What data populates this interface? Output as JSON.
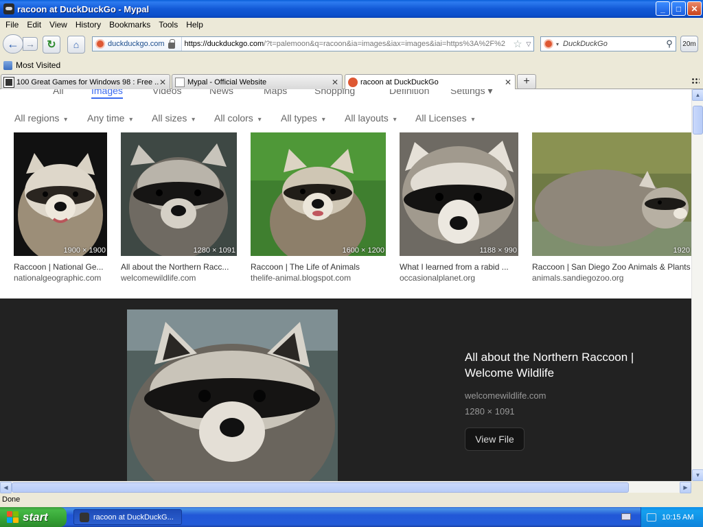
{
  "window": {
    "title": "racoon at DuckDuckGo - Mypal",
    "min": "_",
    "max": "□",
    "close": "✕"
  },
  "menu": [
    "File",
    "Edit",
    "View",
    "History",
    "Bookmarks",
    "Tools",
    "Help"
  ],
  "nav": {
    "back": "←",
    "forward": "→",
    "reload": "↻",
    "home": "⌂",
    "identity_host": "duckduckgo.com",
    "url_host": "https://duckduckgo.com",
    "url_path": "/?t=palemoon&q=racoon&ia=images&iax=images&iai=https%3A%2F%2",
    "star": "☆",
    "dropmarker": "▽",
    "search_placeholder": "DuckDuckGo",
    "search_caret": "▾",
    "magnifier": "⚲",
    "zoom_label": "20m"
  },
  "bookmarks": {
    "most_visited": "Most Visited"
  },
  "tabs": [
    {
      "label": "100 Great Games for Windows 98 : Free ...",
      "close": "✕"
    },
    {
      "label": "Mypal - Official Website",
      "close": "✕"
    },
    {
      "label": "racoon at DuckDuckGo",
      "close": "✕"
    }
  ],
  "newtab": "+",
  "ddg_tabs": [
    "All",
    "Images",
    "Videos",
    "News",
    "Maps",
    "Shopping",
    "Definition",
    "Settings ▾"
  ],
  "filters": [
    "All regions",
    "Any time",
    "All sizes",
    "All colors",
    "All types",
    "All layouts",
    "All Licenses"
  ],
  "images": [
    {
      "dims": "1900 × 1900",
      "caption": "Raccoon | National Ge...",
      "source": "nationalgeographic.com"
    },
    {
      "dims": "1280 × 1091",
      "caption": "All about the Northern Racc...",
      "source": "welcomewildlife.com"
    },
    {
      "dims": "1600 × 1200",
      "caption": "Raccoon | The Life of Animals",
      "source": "thelife-animal.blogspot.com"
    },
    {
      "dims": "1188 × 990",
      "caption": "What I learned from a rabid ...",
      "source": "occasionalplanet.org"
    },
    {
      "dims": "1920",
      "caption": "Raccoon | San Diego Zoo Animals & Plants",
      "source": "animals.sandiegozoo.org"
    }
  ],
  "detail": {
    "title": "All about the Northern Raccoon | Welcome Wildlife",
    "source": "welcomewildlife.com",
    "dims": "1280 × 1091",
    "view_file": "View File"
  },
  "scroll": {
    "up": "▲",
    "down": "▼",
    "left": "◀",
    "right": "▶"
  },
  "status": "Done",
  "taskbar": {
    "start": "start",
    "task": "racoon at DuckDuckG...",
    "clock": "10:15 AM"
  }
}
